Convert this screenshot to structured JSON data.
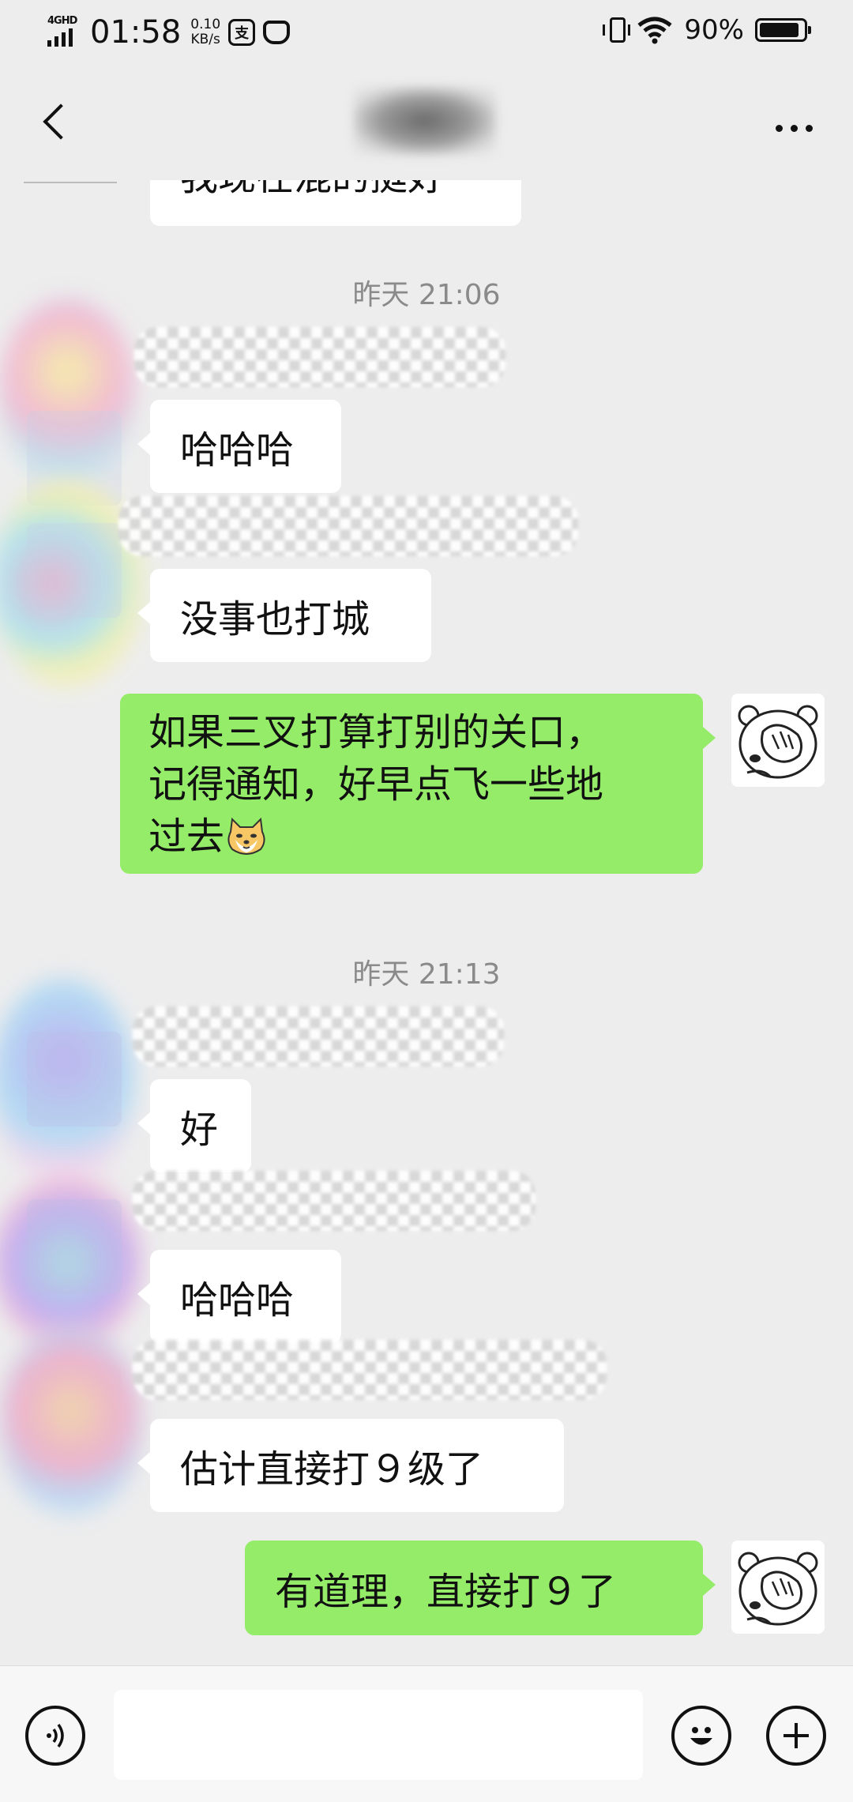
{
  "status_bar": {
    "network": "4GHD",
    "time": "01:58",
    "speed_value": "0.10",
    "speed_unit": "KB/s",
    "battery_percent": "90%",
    "battery_level": 0.9
  },
  "header": {
    "title_redacted": true
  },
  "messages": {
    "top_partial": "我现在混的挺好",
    "ts1": "昨天 21:06",
    "m1": "哈哈哈",
    "m2": "没事也打城",
    "me1_line1": "如果三叉打算打别的关口，",
    "me1_line2": "记得通知，好早点飞一些地",
    "me1_line3": "过去",
    "ts2": "昨天 21:13",
    "m3": "好",
    "m4": "哈哈哈",
    "m5": "估计直接打９级了",
    "me2": "有道理，直接打９了"
  },
  "input": {
    "value": ""
  },
  "colors": {
    "background": "#ededed",
    "my_bubble": "#95ec69",
    "other_bubble": "#ffffff",
    "timestamp": "#8a8a8a"
  },
  "icons": [
    "back-chevron-icon",
    "more-dots-icon",
    "voice-icon",
    "emoji-icon",
    "plus-icon"
  ]
}
